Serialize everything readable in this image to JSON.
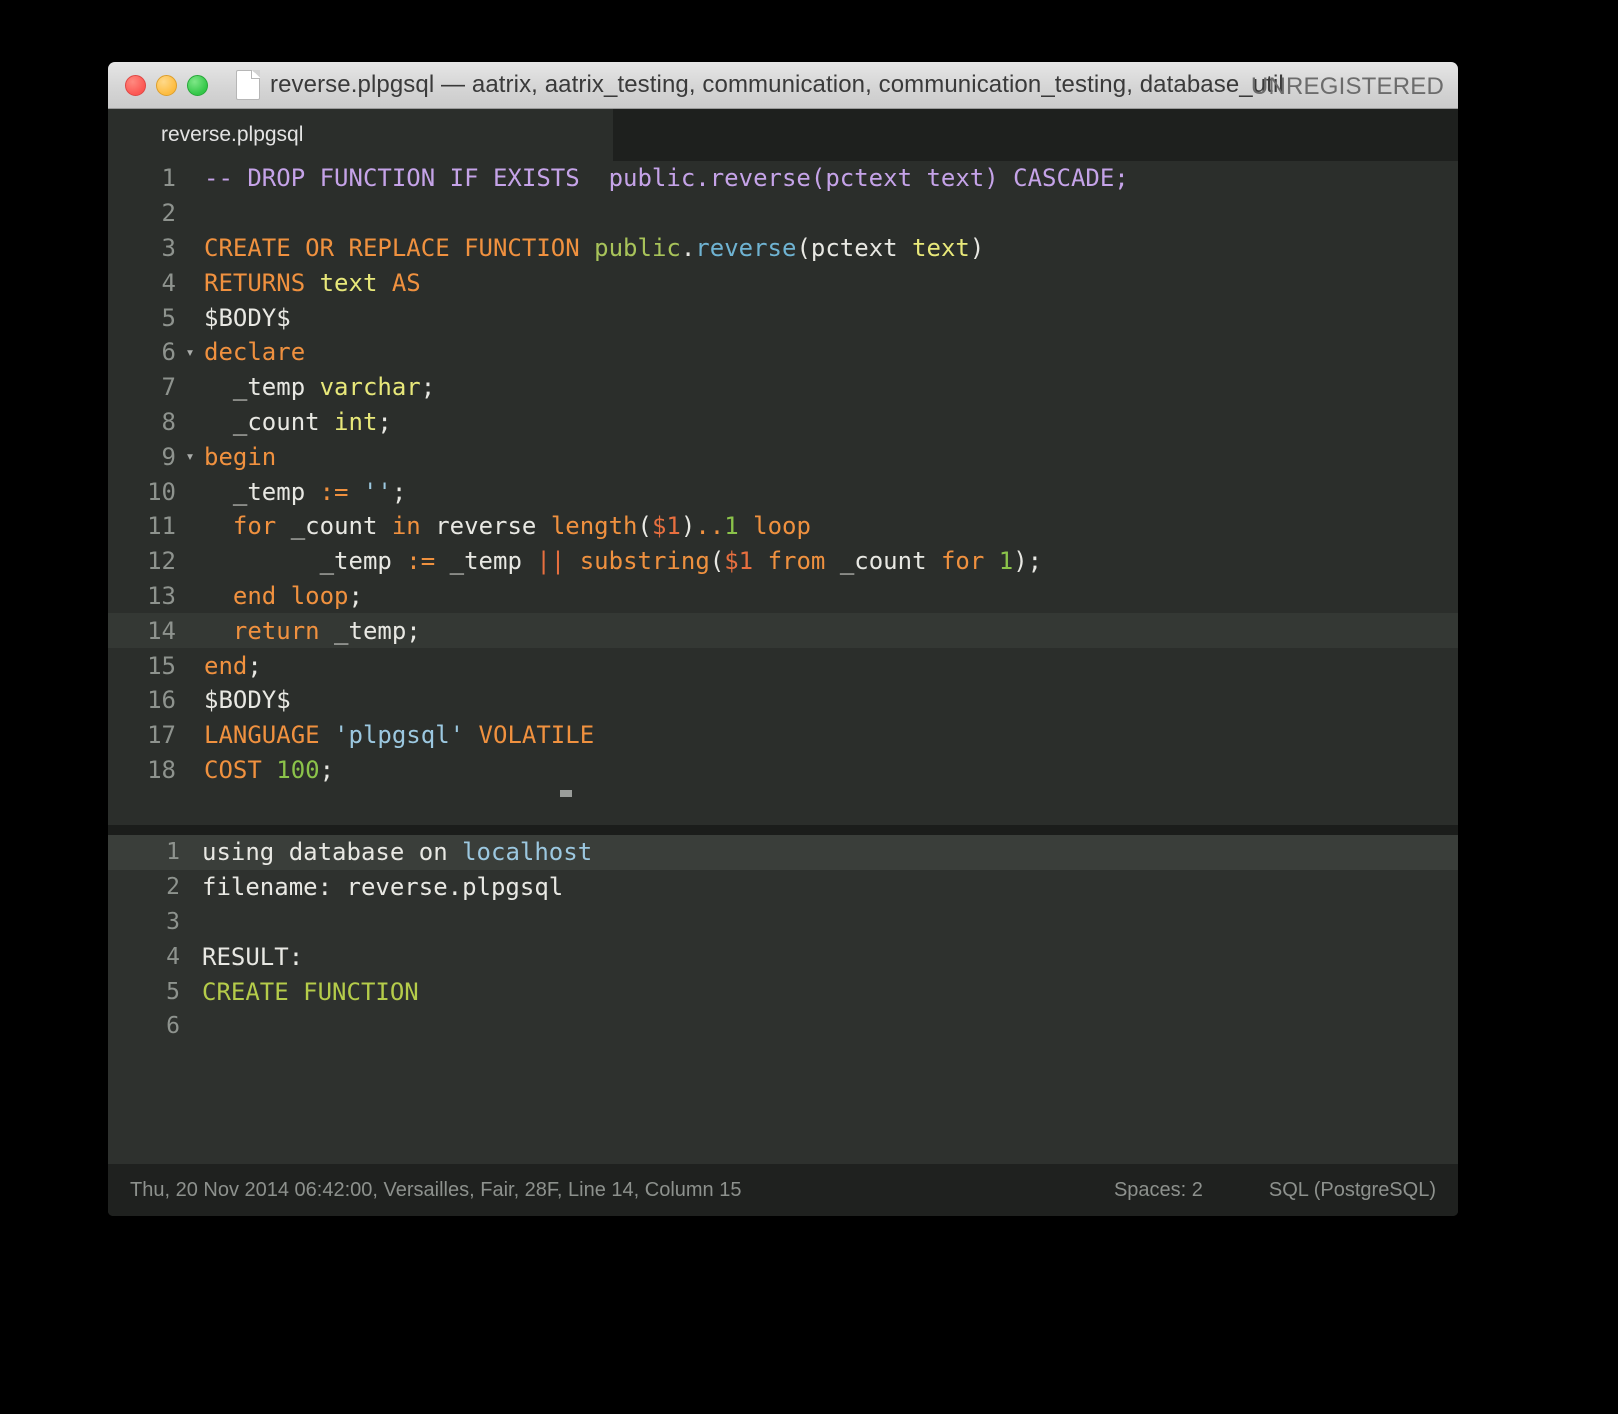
{
  "window": {
    "title": "reverse.plpgsql — aatrix, aatrix_testing, communication, communication_testing, database_util",
    "watermark": "UNREGISTERED",
    "doc_icon": "document-icon",
    "traffic_lights": [
      "close",
      "minimize",
      "maximize"
    ]
  },
  "tabs": [
    {
      "label": "reverse.plpgsql",
      "active": true
    }
  ],
  "editor": {
    "lines": [
      {
        "num": "1",
        "fold": "",
        "current": false,
        "tokens": [
          {
            "t": "-- DROP FUNCTION IF EXISTS  public.reverse(pctext text) CASCADE;",
            "c": "c-comment"
          }
        ]
      },
      {
        "num": "2",
        "fold": "",
        "current": false,
        "tokens": [
          {
            "t": "",
            "c": "c-plain"
          }
        ]
      },
      {
        "num": "3",
        "fold": "",
        "current": false,
        "tokens": [
          {
            "t": "CREATE OR REPLACE FUNCTION ",
            "c": "c-keyword"
          },
          {
            "t": "public",
            "c": "c-ns"
          },
          {
            "t": ".",
            "c": "c-plain"
          },
          {
            "t": "reverse",
            "c": "c-func"
          },
          {
            "t": "(pctext ",
            "c": "c-plain"
          },
          {
            "t": "text",
            "c": "c-type"
          },
          {
            "t": ")",
            "c": "c-plain"
          }
        ]
      },
      {
        "num": "4",
        "fold": "",
        "current": false,
        "tokens": [
          {
            "t": "RETURNS ",
            "c": "c-keyword"
          },
          {
            "t": "text",
            "c": "c-type"
          },
          {
            "t": " AS",
            "c": "c-keyword"
          }
        ]
      },
      {
        "num": "5",
        "fold": "",
        "current": false,
        "tokens": [
          {
            "t": "$BODY$",
            "c": "c-plain"
          }
        ]
      },
      {
        "num": "6",
        "fold": "▾",
        "current": false,
        "tokens": [
          {
            "t": "declare",
            "c": "c-keyword"
          }
        ]
      },
      {
        "num": "7",
        "fold": "",
        "current": false,
        "tokens": [
          {
            "t": "  _temp ",
            "c": "c-plain"
          },
          {
            "t": "varchar",
            "c": "c-type"
          },
          {
            "t": ";",
            "c": "c-plain"
          }
        ]
      },
      {
        "num": "8",
        "fold": "",
        "current": false,
        "tokens": [
          {
            "t": "  _count ",
            "c": "c-plain"
          },
          {
            "t": "int",
            "c": "c-type"
          },
          {
            "t": ";",
            "c": "c-plain"
          }
        ]
      },
      {
        "num": "9",
        "fold": "▾",
        "current": false,
        "tokens": [
          {
            "t": "begin",
            "c": "c-keyword"
          }
        ]
      },
      {
        "num": "10",
        "fold": "",
        "current": false,
        "tokens": [
          {
            "t": "  _temp ",
            "c": "c-plain"
          },
          {
            "t": ":=",
            "c": "c-keyword"
          },
          {
            "t": " ",
            "c": "c-plain"
          },
          {
            "t": "''",
            "c": "c-str"
          },
          {
            "t": ";",
            "c": "c-plain"
          }
        ]
      },
      {
        "num": "11",
        "fold": "",
        "current": false,
        "tokens": [
          {
            "t": "  ",
            "c": "c-plain"
          },
          {
            "t": "for",
            "c": "c-keyword"
          },
          {
            "t": " _count ",
            "c": "c-plain"
          },
          {
            "t": "in",
            "c": "c-keyword"
          },
          {
            "t": " reverse ",
            "c": "c-plain"
          },
          {
            "t": "length",
            "c": "c-keyword"
          },
          {
            "t": "(",
            "c": "c-plain"
          },
          {
            "t": "$1",
            "c": "c-param"
          },
          {
            "t": ")",
            "c": "c-plain"
          },
          {
            "t": "..",
            "c": "c-keyword"
          },
          {
            "t": "1",
            "c": "c-num"
          },
          {
            "t": " ",
            "c": "c-plain"
          },
          {
            "t": "loop",
            "c": "c-keyword"
          }
        ]
      },
      {
        "num": "12",
        "fold": "",
        "current": false,
        "tokens": [
          {
            "t": "        _temp ",
            "c": "c-plain"
          },
          {
            "t": ":=",
            "c": "c-keyword"
          },
          {
            "t": " _temp ",
            "c": "c-plain"
          },
          {
            "t": "||",
            "c": "c-param"
          },
          {
            "t": " ",
            "c": "c-plain"
          },
          {
            "t": "substring",
            "c": "c-keyword"
          },
          {
            "t": "(",
            "c": "c-plain"
          },
          {
            "t": "$1",
            "c": "c-param"
          },
          {
            "t": " ",
            "c": "c-plain"
          },
          {
            "t": "from",
            "c": "c-keyword"
          },
          {
            "t": " _count ",
            "c": "c-plain"
          },
          {
            "t": "for",
            "c": "c-keyword"
          },
          {
            "t": " ",
            "c": "c-plain"
          },
          {
            "t": "1",
            "c": "c-num"
          },
          {
            "t": ");",
            "c": "c-plain"
          }
        ]
      },
      {
        "num": "13",
        "fold": "",
        "current": false,
        "tokens": [
          {
            "t": "  ",
            "c": "c-plain"
          },
          {
            "t": "end loop",
            "c": "c-keyword"
          },
          {
            "t": ";",
            "c": "c-plain"
          }
        ]
      },
      {
        "num": "14",
        "fold": "",
        "current": true,
        "tokens": [
          {
            "t": "  ",
            "c": "c-plain"
          },
          {
            "t": "return",
            "c": "c-keyword"
          },
          {
            "t": " _temp;",
            "c": "c-plain"
          }
        ]
      },
      {
        "num": "15",
        "fold": "",
        "current": false,
        "tokens": [
          {
            "t": "end",
            "c": "c-keyword"
          },
          {
            "t": ";",
            "c": "c-plain"
          }
        ]
      },
      {
        "num": "16",
        "fold": "",
        "current": false,
        "tokens": [
          {
            "t": "$BODY$",
            "c": "c-plain"
          }
        ]
      },
      {
        "num": "17",
        "fold": "",
        "current": false,
        "tokens": [
          {
            "t": "LANGUAGE ",
            "c": "c-keyword"
          },
          {
            "t": "'plpgsql'",
            "c": "c-str"
          },
          {
            "t": " VOLATILE",
            "c": "c-keyword"
          }
        ]
      },
      {
        "num": "18",
        "fold": "",
        "current": false,
        "tokens": [
          {
            "t": "COST ",
            "c": "c-keyword"
          },
          {
            "t": "100",
            "c": "c-num"
          },
          {
            "t": ";",
            "c": "c-plain"
          }
        ]
      }
    ]
  },
  "output": {
    "lines": [
      {
        "num": "1",
        "current": true,
        "tokens": [
          {
            "t": "using database on ",
            "c": "c-plain"
          },
          {
            "t": "localhost",
            "c": "o-blue"
          }
        ]
      },
      {
        "num": "2",
        "current": false,
        "tokens": [
          {
            "t": "filename: reverse.plpgsql",
            "c": "c-plain"
          }
        ]
      },
      {
        "num": "3",
        "current": false,
        "tokens": [
          {
            "t": "",
            "c": "c-plain"
          }
        ]
      },
      {
        "num": "4",
        "current": false,
        "tokens": [
          {
            "t": "RESULT:",
            "c": "c-plain"
          }
        ]
      },
      {
        "num": "5",
        "current": false,
        "tokens": [
          {
            "t": "CREATE FUNCTION",
            "c": "o-green"
          }
        ]
      },
      {
        "num": "6",
        "current": false,
        "tokens": [
          {
            "t": "",
            "c": "c-plain"
          }
        ]
      }
    ]
  },
  "statusbar": {
    "left": "Thu, 20 Nov 2014 06:42:00, Versailles, Fair, 28F, Line 14, Column 15",
    "spaces": "Spaces: 2",
    "syntax": "SQL (PostgreSQL)"
  },
  "colors": {
    "window_chrome": "#d6d6d6",
    "editor_bg": "#2b2e2b",
    "output_bg": "#2e312e",
    "statusbar_bg": "#1f211f",
    "keyword": "#f0913f",
    "comment": "#c5a3e8",
    "type": "#e8e87a",
    "function": "#6fb3d2",
    "namespace": "#a8c35a",
    "number": "#8bc34a",
    "string": "#9cc8e0",
    "param": "#e86f3f",
    "text": "#e8e8e3"
  }
}
